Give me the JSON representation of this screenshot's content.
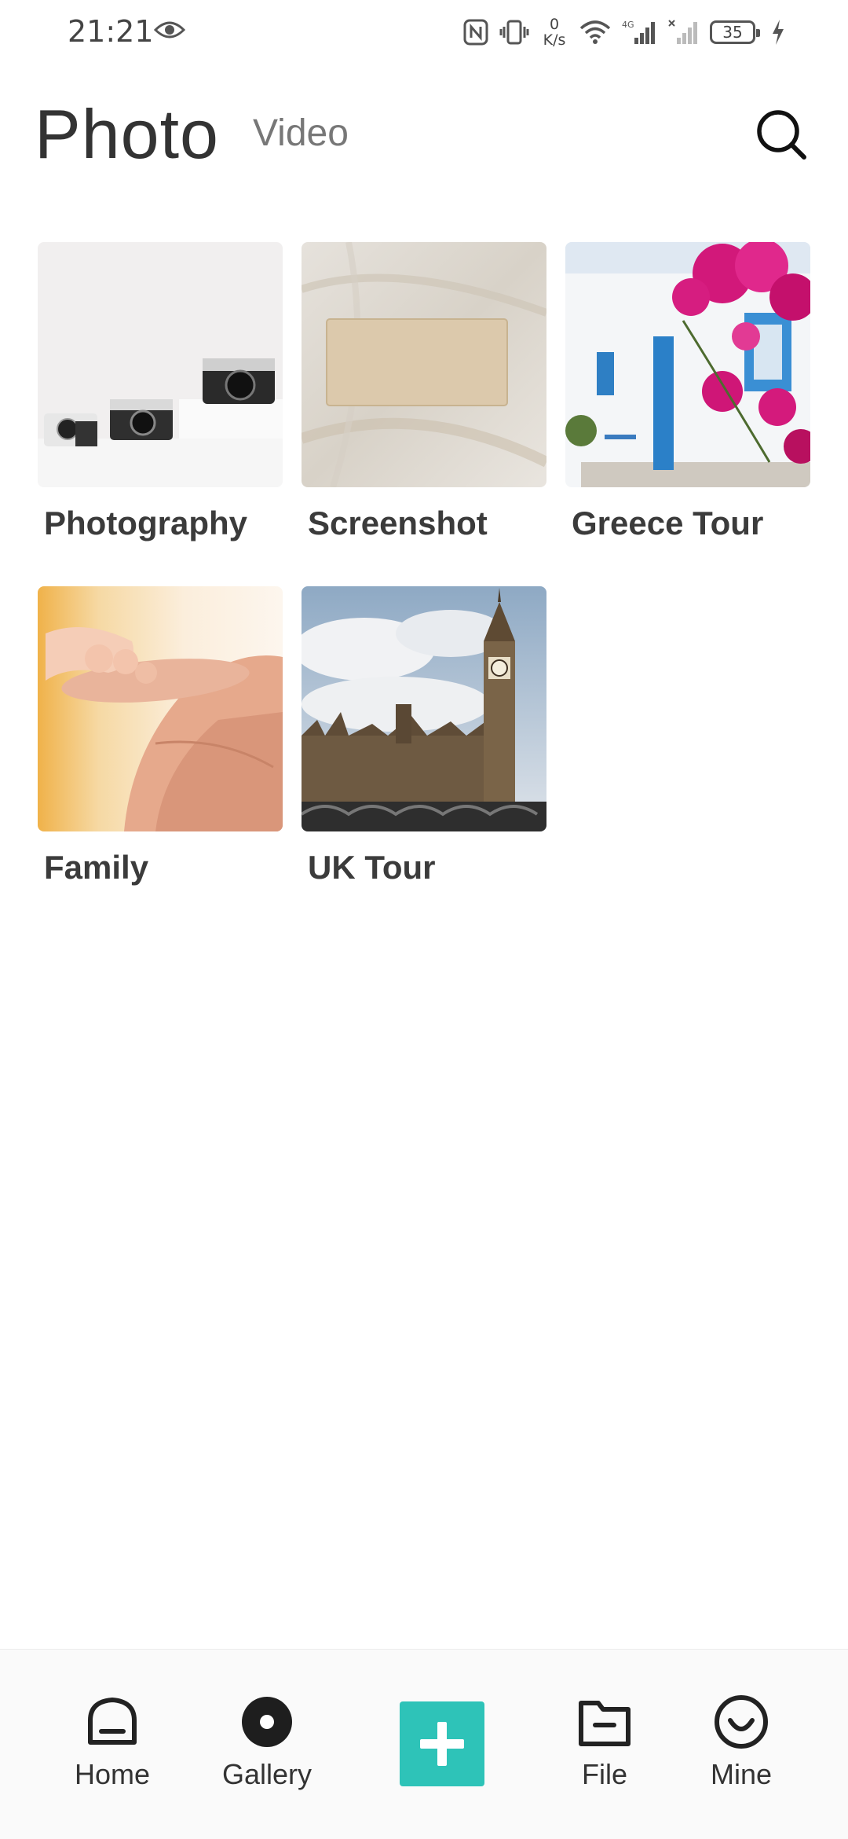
{
  "status_bar": {
    "time": "21:21",
    "speed_value": "0",
    "speed_unit": "K/s",
    "battery": "35"
  },
  "header": {
    "active_tab": "Photo",
    "inactive_tab": "Video"
  },
  "albums": [
    {
      "label": "Photography",
      "image": "cameras-on-white-table"
    },
    {
      "label": "Screenshot",
      "image": "wooden-block-on-linen"
    },
    {
      "label": "Greece Tour",
      "image": "white-house-blue-door-bougainvillea"
    },
    {
      "label": "Family",
      "image": "baby-hand-holding-finger"
    },
    {
      "label": "UK Tour",
      "image": "big-ben-westminster"
    }
  ],
  "bottom_nav": {
    "home": "Home",
    "gallery": "Gallery",
    "file": "File",
    "mine": "Mine"
  },
  "colors": {
    "accent": "#2ec3b8",
    "text_primary": "#333333",
    "text_secondary": "#777777"
  }
}
